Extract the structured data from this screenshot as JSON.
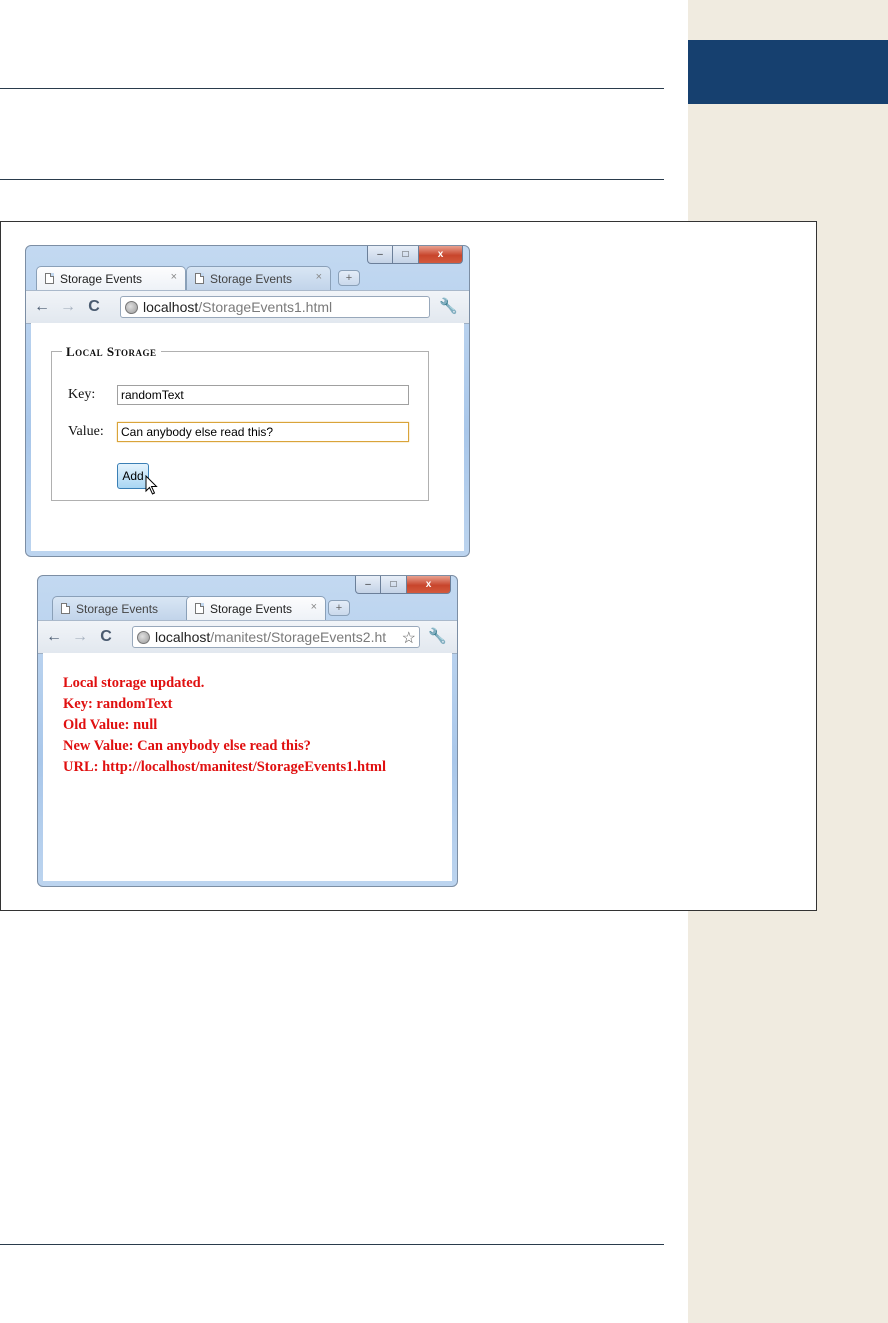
{
  "browser1": {
    "tabs": [
      {
        "label": "Storage Events",
        "active": true
      },
      {
        "label": "Storage Events",
        "active": false
      }
    ],
    "address": {
      "host": "localhost",
      "path": "/StorageEvents1.html"
    },
    "fieldset": {
      "legend": "Local Storage",
      "key_label": "Key:",
      "key_value": "randomText",
      "value_label": "Value:",
      "value_value": "Can anybody else read this?",
      "add_label": "Add"
    }
  },
  "browser2": {
    "tabs": [
      {
        "label": "Storage Events",
        "active": false
      },
      {
        "label": "Storage Events",
        "active": true
      }
    ],
    "address": {
      "host": "localhost",
      "path": "/manitest/StorageEvents2.ht"
    },
    "messages": [
      "Local storage updated.",
      "Key: randomText",
      "Old Value: null",
      "New Value: Can anybody else read this?",
      "URL: http://localhost/manitest/StorageEvents1.html"
    ]
  },
  "icons": {
    "close_tab": "×",
    "new_tab": "+",
    "minimize": "–",
    "maximize": "□",
    "close_window": "x",
    "back": "←",
    "forward": "→",
    "reload": "C",
    "bookmark": "☆",
    "wrench": "🔧"
  }
}
